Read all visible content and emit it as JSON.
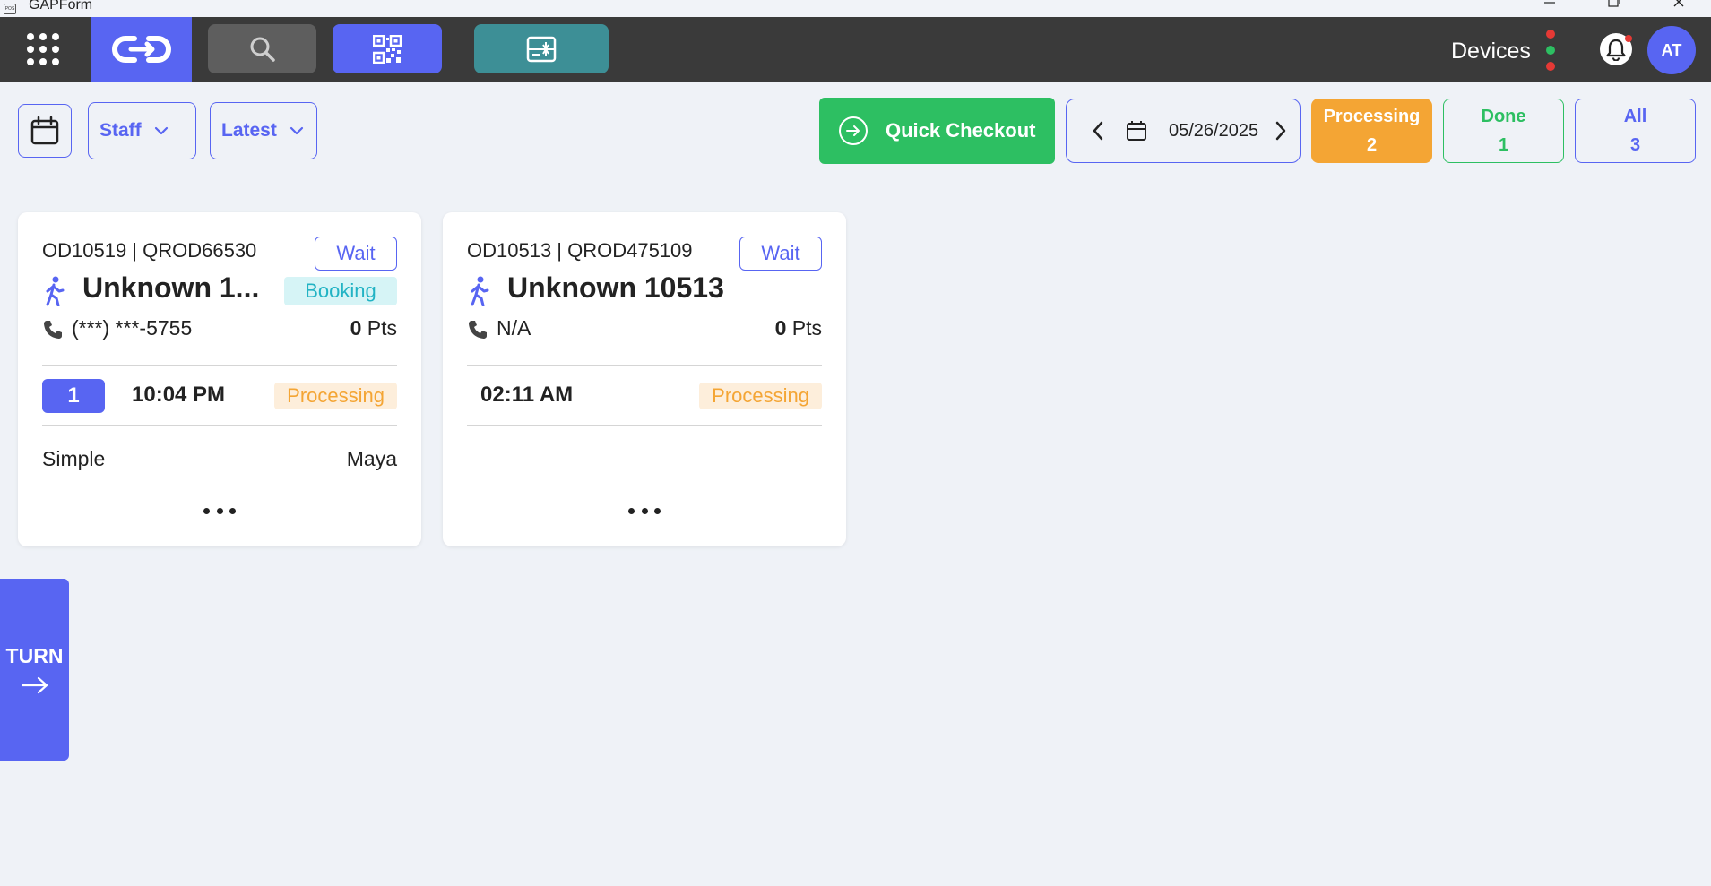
{
  "window": {
    "title": "GAPForm",
    "app_icon_text": "POS"
  },
  "topbar": {
    "devices_label": "Devices",
    "device_status_colors": [
      "#e53935",
      "#2dbf62",
      "#e53935"
    ],
    "avatar_initials": "AT",
    "buttons": [
      "grid-menu-icon",
      "link-logo-icon",
      "search-icon",
      "qr-code-icon",
      "panel-icon"
    ],
    "colors": {
      "bar": "#3a3a3a",
      "accent": "#5865f2",
      "teal": "#3d8f96"
    }
  },
  "toolbar": {
    "staff_label": "Staff",
    "sort_label": "Latest",
    "quick_checkout_label": "Quick Checkout",
    "date": "05/26/2025",
    "filters": {
      "processing": {
        "label": "Processing",
        "count": "2"
      },
      "done": {
        "label": "Done",
        "count": "1"
      },
      "all": {
        "label": "All",
        "count": "3"
      }
    }
  },
  "cards": [
    {
      "ids": "OD10519 | QROD66530",
      "wait_label": "Wait",
      "name": "Unknown 1...",
      "tag": "Booking",
      "phone": "(***) ***-5755",
      "points": "0",
      "points_unit": "Pts",
      "turn_number": "1",
      "time": "10:04 PM",
      "status": "Processing",
      "service": "Simple",
      "staff": "Maya"
    },
    {
      "ids": "OD10513 | QROD475109",
      "wait_label": "Wait",
      "name": "Unknown 10513",
      "phone": "N/A",
      "points": "0",
      "points_unit": "Pts",
      "time": "02:11 AM",
      "status": "Processing"
    }
  ],
  "turn_button": {
    "label": "TURN"
  }
}
